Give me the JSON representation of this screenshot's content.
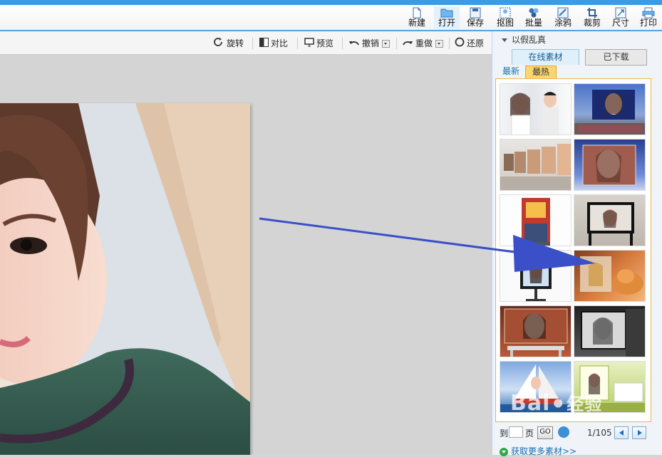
{
  "toolbar": {
    "buttons": [
      {
        "id": "new",
        "label": "新建",
        "icon": "new-file-icon"
      },
      {
        "id": "open",
        "label": "打开",
        "icon": "folder-icon"
      },
      {
        "id": "save",
        "label": "保存",
        "icon": "floppy-icon"
      },
      {
        "id": "cutout",
        "label": "抠图",
        "icon": "cutout-icon"
      },
      {
        "id": "batch",
        "label": "批量",
        "icon": "batch-icon"
      },
      {
        "id": "doodle",
        "label": "涂鸦",
        "icon": "doodle-icon"
      },
      {
        "id": "crop",
        "label": "裁剪",
        "icon": "crop-icon"
      },
      {
        "id": "size",
        "label": "尺寸",
        "icon": "resize-icon"
      },
      {
        "id": "print",
        "label": "打印",
        "icon": "printer-icon"
      }
    ]
  },
  "edit_toolbar": {
    "rotate": "旋转",
    "compare": "对比",
    "preview": "预览",
    "undo": "撤销",
    "redo": "重做",
    "restore": "还原"
  },
  "panel": {
    "title": "以假乱真",
    "tabs": {
      "online": "在线素材",
      "downloaded": "已下载"
    },
    "subtabs": {
      "newest": "最新",
      "hottest": "最热"
    },
    "templates_count": 12,
    "pager": {
      "to_label": "到",
      "page_label": "页",
      "go_label": "GO",
      "page_input": "",
      "page_indicator": "1/105"
    },
    "more_link": "获取更多素材>>"
  },
  "colors": {
    "accent_blue": "#3d9be3",
    "grid_border": "#e8b64b",
    "hot_tab": "#fcd56e",
    "arrow": "#3a4fc8"
  },
  "watermark": {
    "text": "Bai",
    "sub": "经验"
  }
}
